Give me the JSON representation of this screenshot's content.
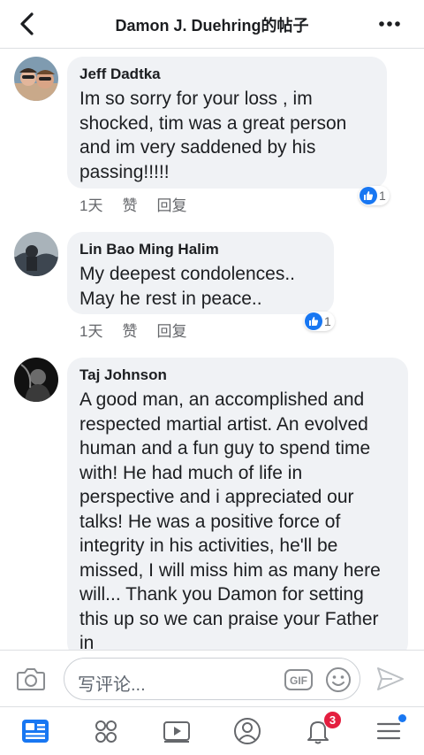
{
  "header": {
    "title": "Damon J. Duehring的帖子",
    "back_icon": "chevron-left-icon",
    "more_icon": "more-horizontal-icon"
  },
  "comments": [
    {
      "author": "Jeff Dadtka",
      "text": "Im so sorry for your loss , im shocked, tim was a great person and im very saddened by his passing!!!!!",
      "time": "1天",
      "like": "赞",
      "reply": "回复",
      "reactions": "1"
    },
    {
      "author": "Lin Bao Ming Halim",
      "text": "My deepest condolences.. May he rest in peace..",
      "time": "1天",
      "like": "赞",
      "reply": "回复",
      "reactions": "1"
    },
    {
      "author": "Taj Johnson",
      "text": "A good man, an accomplished and respected martial artist. An evolved human and a fun guy to spend time with! He had much of life in perspective and i appreciated our talks! He was a positive force of integrity in his activities, he'll be missed, I will miss him as many here will... Thank you Damon for setting this up so we can praise your Father in"
    }
  ],
  "composer": {
    "placeholder": "写评论...",
    "gif_label": "GIF"
  },
  "nav": {
    "notifications_count": "3"
  },
  "colors": {
    "accent": "#1877f2",
    "bubble": "#f0f2f5",
    "badge": "#e41e3f"
  }
}
